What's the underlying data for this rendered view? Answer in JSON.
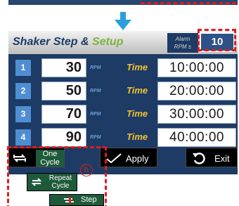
{
  "header": {
    "title_part1": "Shaker Step",
    "title_amp": "&",
    "title_part2": "Setup",
    "alarm_label_line1": "Alarm",
    "alarm_label_line2": "RPM ±",
    "alarm_value": "10"
  },
  "steps": [
    {
      "index": "1",
      "rpm": "30",
      "rpm_unit": "RPM",
      "time_label": "Time",
      "time": "10:00:00"
    },
    {
      "index": "2",
      "rpm": "50",
      "rpm_unit": "RPM",
      "time_label": "Time",
      "time": "20:00:00"
    },
    {
      "index": "3",
      "rpm": "70",
      "rpm_unit": "RPM",
      "time_label": "Time",
      "time": "30:00:00"
    },
    {
      "index": "4",
      "rpm": "90",
      "rpm_unit": "RPM",
      "time_label": "Time",
      "time": "40:00:00"
    }
  ],
  "buttons": {
    "one_cycle_line1": "One",
    "one_cycle_line2": "Cycle",
    "apply": "Apply",
    "exit": "Exit",
    "repeat_cycle_line1": "Repeat",
    "repeat_cycle_line2": "Cycle",
    "step": "Step"
  },
  "annotation": {
    "badge": "h"
  },
  "colors": {
    "panel": "#1d3b64",
    "accent_green": "#7db43a",
    "time_label": "#f2c230",
    "index_badge": "#4f8ed3",
    "annotation_red": "#e01b1b"
  },
  "icons": {
    "cycle": "cycle-icon",
    "apply": "check-icon",
    "exit": "undo-icon",
    "step": "step-icon",
    "down_arrow": "arrow-down-icon"
  }
}
